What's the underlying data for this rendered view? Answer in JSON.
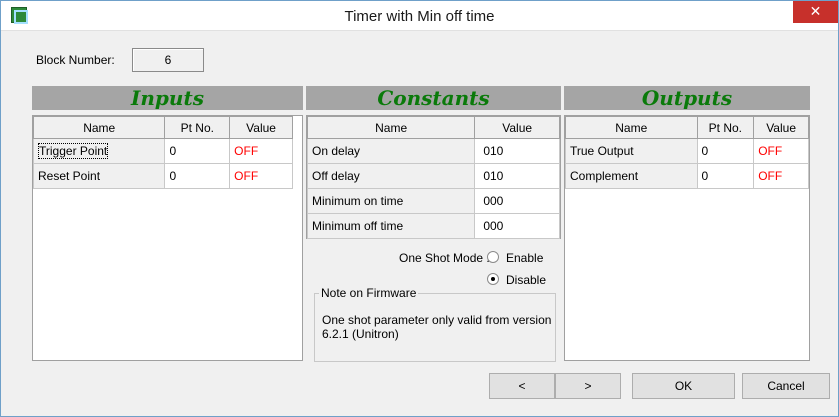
{
  "window": {
    "title": "Timer with Min off time",
    "close_glyph": "✕",
    "app_icon": "ladder-block-icon"
  },
  "block_number": {
    "label": "Block Number:",
    "value": "6"
  },
  "sections": {
    "inputs": "Inputs",
    "constants": "Constants",
    "outputs": "Outputs",
    "title_color": "#0a7a0a"
  },
  "inputs_table": {
    "headers": [
      "Name",
      "Pt No.",
      "Value"
    ],
    "rows": [
      {
        "name": "Trigger Point",
        "pt": "0",
        "value": "OFF"
      },
      {
        "name": "Reset Point",
        "pt": "0",
        "value": "OFF"
      }
    ]
  },
  "constants_table": {
    "headers": [
      "Name",
      "Value"
    ],
    "rows": [
      {
        "name": "On delay",
        "value": "010"
      },
      {
        "name": "Off delay",
        "value": "010"
      },
      {
        "name": "Minimum on time",
        "value": "000"
      },
      {
        "name": "Minimum off time",
        "value": "000"
      }
    ]
  },
  "outputs_table": {
    "headers": [
      "Name",
      "Pt No.",
      "Value"
    ],
    "rows": [
      {
        "name": "True Output",
        "pt": "0",
        "value": "OFF"
      },
      {
        "name": "Complement",
        "pt": "0",
        "value": "OFF"
      }
    ]
  },
  "one_shot": {
    "label": "One Shot Mode :",
    "options": [
      "Enable",
      "Disable"
    ],
    "selected": "Disable"
  },
  "firmware_note": {
    "title": "Note on Firmware",
    "text": "One shot parameter only valid from version 6.2.1 (Unitron)"
  },
  "buttons": {
    "prev": "<",
    "next": ">",
    "ok": "OK",
    "cancel": "Cancel"
  },
  "colors": {
    "off_value": "#ff0000",
    "close_button": "#c7302b",
    "header_band": "#a5a5a5"
  }
}
